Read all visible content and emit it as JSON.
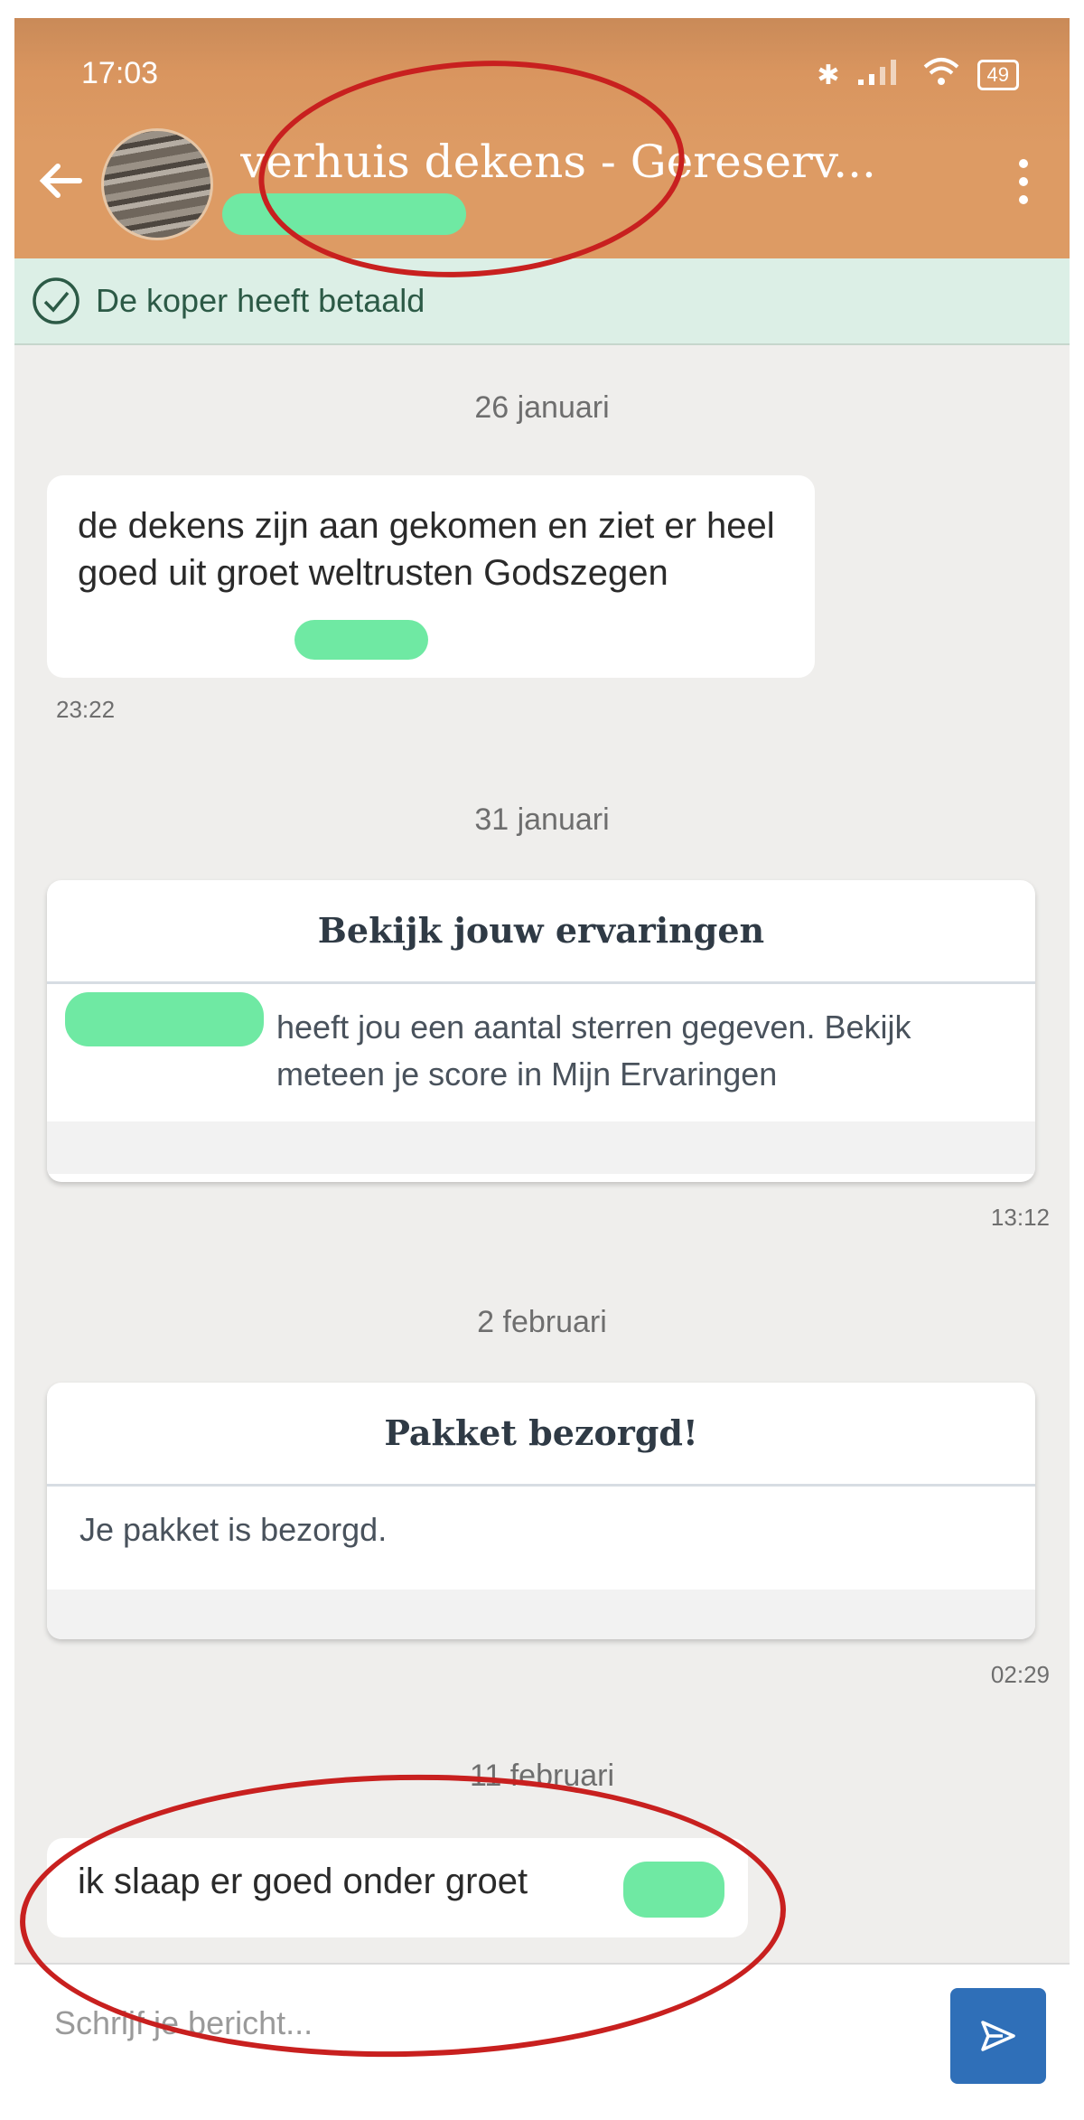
{
  "status_bar": {
    "time": "17:03",
    "battery": "49"
  },
  "header": {
    "title": "verhuis dekens - Gereserv..."
  },
  "payment_banner": {
    "text": "De koper heeft betaald"
  },
  "messages": [
    {
      "date": "26 januari",
      "text": "de dekens zijn aan gekomen en ziet er heel goed uit groet weltrusten Godszegen",
      "time": "23:22"
    },
    {
      "date": "31 januari",
      "card_title": "Bekijk jouw ervaringen",
      "card_body": "heeft jou een aantal sterren gegeven. Bekijk meteen je score in Mijn Ervaringen",
      "time": "13:12"
    },
    {
      "date": "2 februari",
      "card_title": "Pakket bezorgd!",
      "card_body": "Je pakket is bezorgd.",
      "time": "02:29"
    },
    {
      "date": "11 februari",
      "text": "ik slaap er goed onder groet"
    }
  ],
  "composer": {
    "placeholder": "Schrijf je bericht..."
  },
  "colors": {
    "header": "#dd9b64",
    "banner": "#dcefe6",
    "send_button": "#2f6fb8",
    "annotation": "#c8201f",
    "redaction": "#6fe9a3"
  }
}
